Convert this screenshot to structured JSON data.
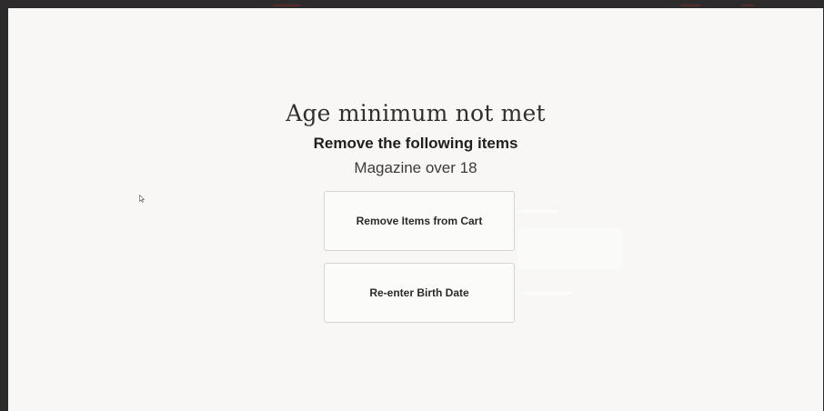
{
  "dialog": {
    "title": "Age minimum not met",
    "subtitle": "Remove the following items",
    "item": "Magazine over 18",
    "remove_button_label": "Remove Items from Cart",
    "reenter_button_label": "Re-enter Birth Date"
  },
  "icons": {
    "cursor": "mouse-pointer-icon"
  },
  "colors": {
    "background": "#f8f7f5",
    "frame": "#2b2b2b",
    "button_border": "#d6d4d2",
    "text": "#2f2f2f"
  }
}
